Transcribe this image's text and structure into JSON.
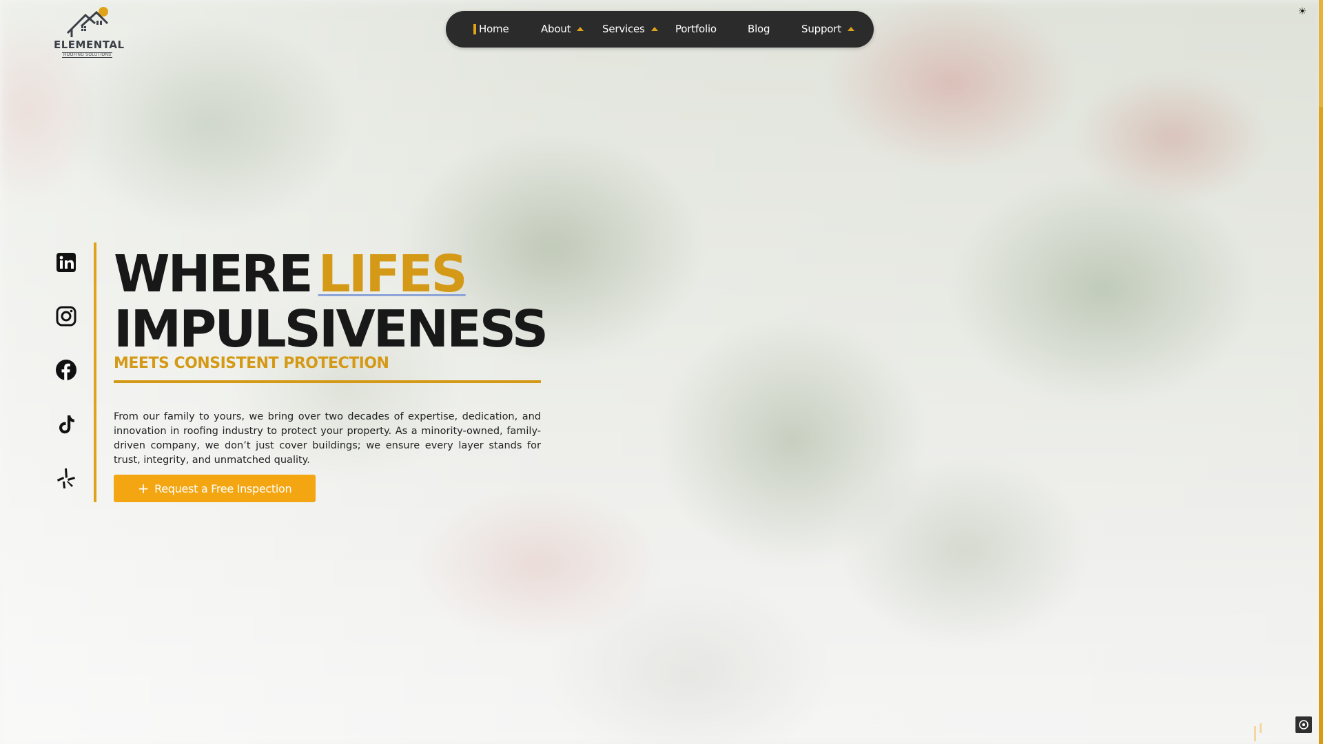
{
  "brand": {
    "logo_name": "ELEMENTAL",
    "logo_tagline": "ROOFING SOLUTIONS",
    "accent_color": "#e0a21a",
    "nav_bg": "#2b2b2b"
  },
  "nav": {
    "items": [
      {
        "label": "Home",
        "active": true,
        "has_dropdown": false
      },
      {
        "label": "About",
        "active": false,
        "has_dropdown": true
      },
      {
        "label": "Services",
        "active": false,
        "has_dropdown": true
      },
      {
        "label": "Portfolio",
        "active": false,
        "has_dropdown": false
      },
      {
        "label": "Blog",
        "active": false,
        "has_dropdown": false
      },
      {
        "label": "Support",
        "active": false,
        "has_dropdown": true
      }
    ]
  },
  "social": [
    "linkedin-icon",
    "instagram-icon",
    "facebook-icon",
    "tiktok-icon",
    "yelp-icon"
  ],
  "hero": {
    "title_part1": "WHERE",
    "title_accent": "LIFES",
    "title_line2": "IMPULSIVENESS",
    "subtitle": "MEETS CONSISTENT PROTECTION",
    "description": "From our family to yours, we bring over two decades of expertise, dedication, and innovation in roofing industry to protect your property. As a minority-owned, family-driven company, we don’t just cover buildings; we ensure every layer stands for trust, integrity, and unmatched quality.",
    "cta_label": "Request a Free Inspection"
  },
  "icons": {
    "theme_toggle": "sun-icon",
    "cta": "plus-icon",
    "widget": "target-icon"
  }
}
